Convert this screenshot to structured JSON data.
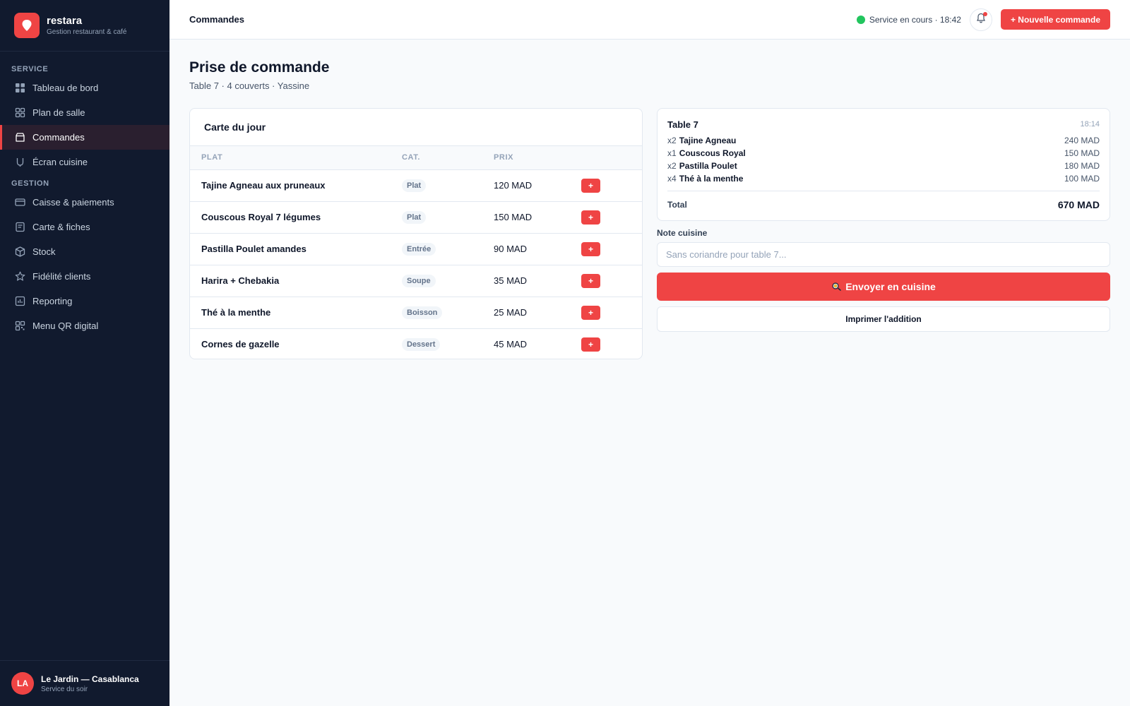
{
  "brand": {
    "name": "restara",
    "subtitle": "Gestion restaurant & café"
  },
  "sidebar": {
    "sections": [
      {
        "label": "SERVICE"
      },
      {
        "label": "GESTION"
      }
    ],
    "items": [
      {
        "label": "Tableau de bord",
        "icon": "dashboard-icon"
      },
      {
        "label": "Plan de salle",
        "icon": "floor-plan-icon"
      },
      {
        "label": "Commandes",
        "icon": "orders-icon",
        "active": true
      },
      {
        "label": "Écran cuisine",
        "icon": "kitchen-icon"
      },
      {
        "label": "Caisse & paiements",
        "icon": "card-icon"
      },
      {
        "label": "Carte & fiches",
        "icon": "menu-card-icon"
      },
      {
        "label": "Stock",
        "icon": "box-icon"
      },
      {
        "label": "Fidélité clients",
        "icon": "star-icon"
      },
      {
        "label": "Reporting",
        "icon": "chart-icon"
      },
      {
        "label": "Menu QR digital",
        "icon": "qr-icon"
      }
    ]
  },
  "profile": {
    "initials": "LA",
    "name": "Le Jardin — Casablanca",
    "subtitle": "Service du soir"
  },
  "topbar": {
    "breadcrumb": "Commandes",
    "status": "Service en cours · 18:42",
    "new_order_label": "+ Nouvelle commande"
  },
  "page": {
    "title": "Prise de commande",
    "subtitle": "Table 7 · 4 couverts · Yassine"
  },
  "menu_card": {
    "title": "Carte du jour",
    "columns": [
      "PLAT",
      "CAT.",
      "PRIX"
    ],
    "rows": [
      {
        "plat": "Tajine Agneau aux pruneaux",
        "cat": "Plat",
        "prix": "120 MAD",
        "add": "+"
      },
      {
        "plat": "Couscous Royal 7 légumes",
        "cat": "Plat",
        "prix": "150 MAD",
        "add": "+"
      },
      {
        "plat": "Pastilla Poulet amandes",
        "cat": "Entrée",
        "prix": "90 MAD",
        "add": "+"
      },
      {
        "plat": "Harira + Chebakia",
        "cat": "Soupe",
        "prix": "35 MAD",
        "add": "+"
      },
      {
        "plat": "Thé à la menthe",
        "cat": "Boisson",
        "prix": "25 MAD",
        "add": "+"
      },
      {
        "plat": "Cornes de gazelle",
        "cat": "Dessert",
        "prix": "45 MAD",
        "add": "+"
      }
    ]
  },
  "order": {
    "table": "Table 7",
    "time": "18:14",
    "lines": [
      {
        "qty": "x2",
        "item": "Tajine Agneau",
        "amount": "240 MAD"
      },
      {
        "qty": "x1",
        "item": "Couscous Royal",
        "amount": "150 MAD"
      },
      {
        "qty": "x2",
        "item": "Pastilla Poulet",
        "amount": "180 MAD"
      },
      {
        "qty": "x4",
        "item": "Thé à la menthe",
        "amount": "100 MAD"
      }
    ],
    "total_label": "Total",
    "total_value": "670 MAD"
  },
  "note": {
    "label": "Note cuisine",
    "placeholder": "Sans coriandre pour table 7..."
  },
  "actions": {
    "send_label": "Envoyer en cuisine",
    "print_label": "Imprimer l'addition"
  },
  "colors": {
    "accent": "#ef4444",
    "sidebar_bg": "#111a2e",
    "status_ok": "#22c55e"
  }
}
